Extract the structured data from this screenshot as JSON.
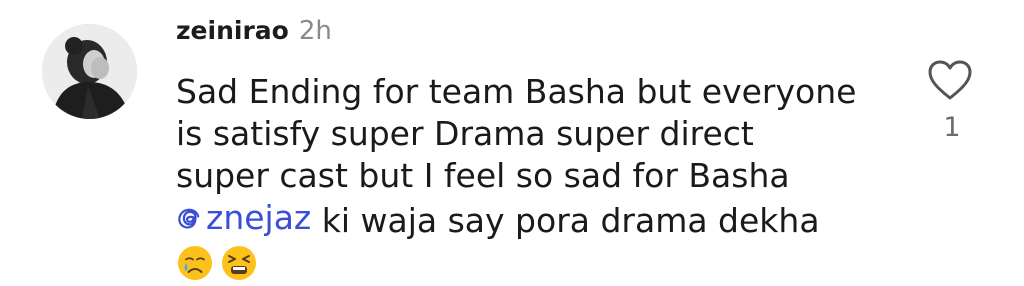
{
  "comment": {
    "username": "zeinirao",
    "time": "2h",
    "lines": [
      "Sad Ending for team Basha but everyone",
      "is satisfy super Drama super direct",
      "super cast but I feel so sad for Basha"
    ],
    "mention": "znejaz",
    "mention_rest": " ki waja say pora drama dekha",
    "emojis": [
      "crying-face-icon",
      "tired-face-icon"
    ],
    "like_icon": "heart-outline-icon",
    "like_count": "1"
  },
  "colors": {
    "mention": "#3b4fd6",
    "timestamp": "#8a8a8a",
    "like_count": "#6b6b6b"
  }
}
